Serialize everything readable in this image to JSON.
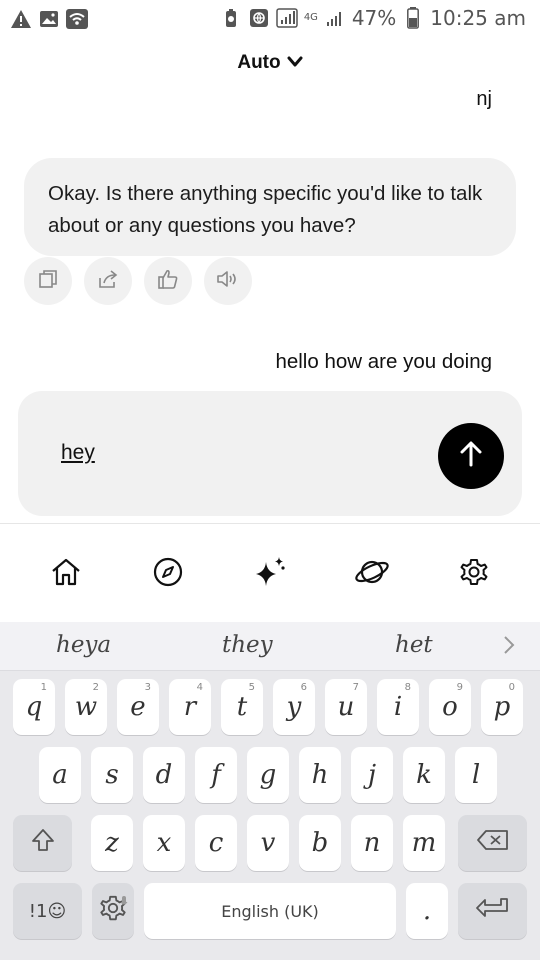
{
  "status": {
    "net_label": "4G",
    "battery": "47%",
    "time": "10:25 am"
  },
  "header": {
    "model_label": "Auto"
  },
  "chat": {
    "user_msg_1": "nj",
    "bot_msg_1": "Okay. Is there anything specific you'd like to talk about or any questions you have?",
    "user_msg_2": "hello how are you doing"
  },
  "composer": {
    "text": "hey"
  },
  "keyboard": {
    "suggestions": [
      "heya",
      "they",
      "het"
    ],
    "row1": [
      {
        "k": "q",
        "h": "1"
      },
      {
        "k": "w",
        "h": "2"
      },
      {
        "k": "e",
        "h": "3"
      },
      {
        "k": "r",
        "h": "4"
      },
      {
        "k": "t",
        "h": "5"
      },
      {
        "k": "y",
        "h": "6"
      },
      {
        "k": "u",
        "h": "7"
      },
      {
        "k": "i",
        "h": "8"
      },
      {
        "k": "o",
        "h": "9"
      },
      {
        "k": "p",
        "h": "0"
      }
    ],
    "row2": [
      "a",
      "s",
      "d",
      "f",
      "g",
      "h",
      "j",
      "k",
      "l"
    ],
    "row3": [
      "z",
      "x",
      "c",
      "v",
      "b",
      "n",
      "m"
    ],
    "symbols_label": "!1☺",
    "space_label": "English (UK)",
    "period_label": "."
  }
}
